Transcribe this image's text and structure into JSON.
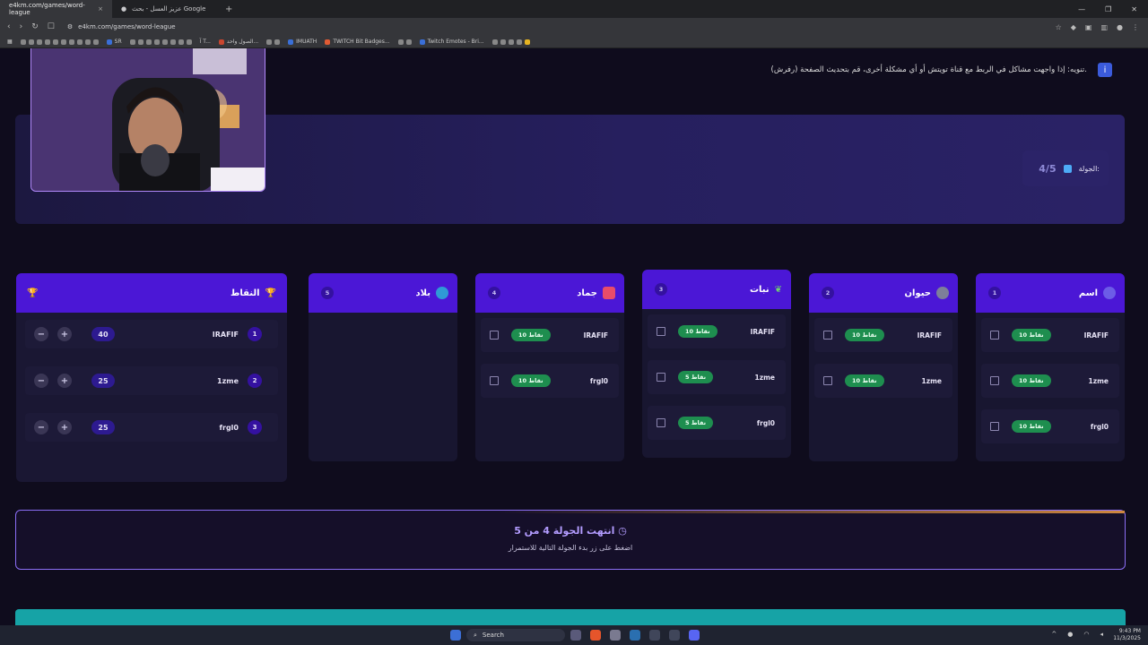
{
  "browser": {
    "tabs": [
      {
        "label": "e4km.com/games/word-league",
        "active": true
      },
      {
        "label": "عزيز العسل - بحث Google",
        "active": false
      }
    ],
    "new_tab": "+",
    "url": "e4km.com/games/word-league",
    "bookmarks": [
      "SR",
      "آ T...",
      "الصول واحد...",
      "IMUATH",
      "TWITCH Bit Badges...",
      "Twitch Emotes - Bri..."
    ]
  },
  "notice": {
    "text": "تنويه: إذا واجهت مشاكل في الربط مع قناة تويتش أو أي مشكلة أخرى، قم بتحديث الصفحة (رفرش)."
  },
  "round": {
    "label": "الجولة:",
    "value": "4/5"
  },
  "score_panel": {
    "title": "النقاط",
    "rows": [
      {
        "rank": "1",
        "name": "IRAFIF",
        "points": "40"
      },
      {
        "rank": "2",
        "name": "1zme",
        "points": "25"
      },
      {
        "rank": "3",
        "name": "frgl0",
        "points": "25"
      }
    ],
    "minus": "−",
    "plus": "+"
  },
  "columns": [
    {
      "num": "1",
      "title": "اسم",
      "color": "#6c5ce7",
      "rows": [
        {
          "name": "IRAFIF",
          "pts": "10 نقاط"
        },
        {
          "name": "1zme",
          "pts": "10 نقاط"
        },
        {
          "name": "frgl0",
          "pts": "10 نقاط"
        }
      ]
    },
    {
      "num": "2",
      "title": "حيوان",
      "color": "#7d7f9a",
      "rows": [
        {
          "name": "IRAFIF",
          "pts": "10 نقاط"
        },
        {
          "name": "1zme",
          "pts": "10 نقاط"
        }
      ]
    },
    {
      "num": "3",
      "title": "نبات",
      "color": "#4caf50",
      "rows": [
        {
          "name": "IRAFIF",
          "pts": "10 نقاط"
        },
        {
          "name": "1zme",
          "pts": "5 نقاط"
        },
        {
          "name": "frgl0",
          "pts": "5 نقاط"
        }
      ]
    },
    {
      "num": "4",
      "title": "جماد",
      "color": "#e94c6a",
      "rows": [
        {
          "name": "IRAFIF",
          "pts": "10 نقاط"
        },
        {
          "name": "frgl0",
          "pts": "10 نقاط"
        }
      ]
    },
    {
      "num": "5",
      "title": "بلاد",
      "color": "#2f9bd6",
      "rows": []
    }
  ],
  "round_end": {
    "title": "انتهت الجولة 4 من 5",
    "subtitle": "اضغط على زر بدء الجولة التالية للاستمرار"
  },
  "taskbar": {
    "search": "Search",
    "time": "9:43 PM",
    "date": "11/3/2025"
  }
}
